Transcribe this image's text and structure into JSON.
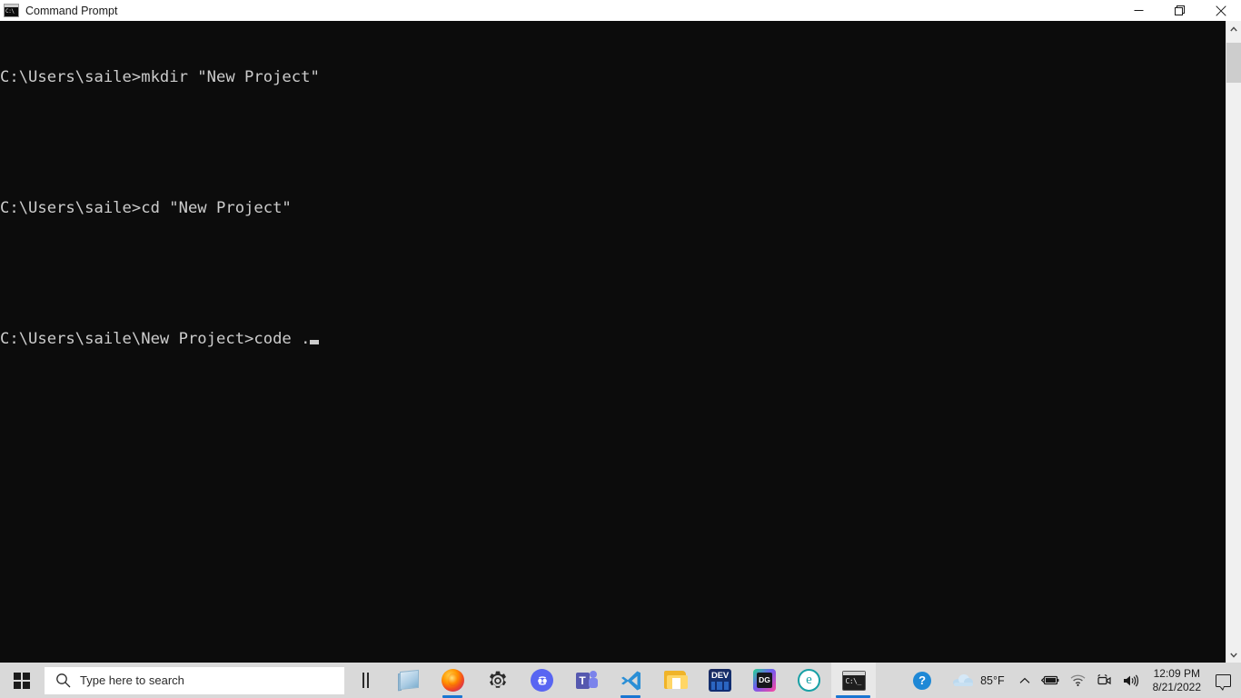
{
  "window": {
    "title": "Command Prompt",
    "icon": "cmd-console-icon",
    "icon_glyph": "C:\\",
    "controls": {
      "minimize_label": "Minimize",
      "maximize_label": "Restore Down",
      "close_label": "Close"
    }
  },
  "terminal": {
    "background": "#0c0c0c",
    "foreground": "#cccccc",
    "lines": [
      "C:\\Users\\saile>mkdir \"New Project\"",
      "",
      "C:\\Users\\saile>cd \"New Project\"",
      "",
      "C:\\Users\\saile\\New Project>code ."
    ],
    "cursor_visible": true
  },
  "scrollbar": {
    "up_arrow": "chevron-up",
    "down_arrow": "chevron-down"
  },
  "taskbar": {
    "background": "#d9d9d9",
    "accent": "#1976d2",
    "start": {
      "label": "Start"
    },
    "search": {
      "placeholder": "Type here to search",
      "value": "",
      "icon": "search-icon"
    },
    "task_view": {
      "label": "Task View"
    },
    "apps": [
      {
        "name": "sticky-notes",
        "label": "Sticky Notes",
        "running": false,
        "active": false
      },
      {
        "name": "firefox",
        "label": "Mozilla Firefox",
        "running": true,
        "active": false
      },
      {
        "name": "settings",
        "label": "Settings",
        "running": false,
        "active": false
      },
      {
        "name": "discord",
        "label": "Discord",
        "running": false,
        "active": false
      },
      {
        "name": "teams",
        "label": "Microsoft Teams",
        "running": false,
        "active": false
      },
      {
        "name": "vscode",
        "label": "Visual Studio Code",
        "running": true,
        "active": false
      },
      {
        "name": "file-explorer",
        "label": "File Explorer",
        "running": false,
        "active": false
      },
      {
        "name": "visual-studio",
        "label": "Visual Studio",
        "running": false,
        "active": false
      },
      {
        "name": "datagrip",
        "label": "DataGrip",
        "running": false,
        "active": false
      },
      {
        "name": "edge",
        "label": "Microsoft Edge",
        "running": false,
        "active": false
      },
      {
        "name": "command-prompt",
        "label": "Command Prompt",
        "running": true,
        "active": true
      }
    ],
    "tray": {
      "help": {
        "icon": "help-icon",
        "glyph": "?"
      },
      "weather": {
        "icon": "cloud-icon",
        "temperature": "85°F"
      },
      "show_hidden": {
        "icon": "chevron-up-icon"
      },
      "battery": {
        "icon": "battery-charging-icon"
      },
      "network": {
        "icon": "wifi-icon"
      },
      "camera": {
        "icon": "camera-icon"
      },
      "volume": {
        "icon": "speaker-icon"
      },
      "clock": {
        "time": "12:09 PM",
        "date": "8/21/2022"
      },
      "notifications": {
        "icon": "notification-icon"
      }
    }
  }
}
